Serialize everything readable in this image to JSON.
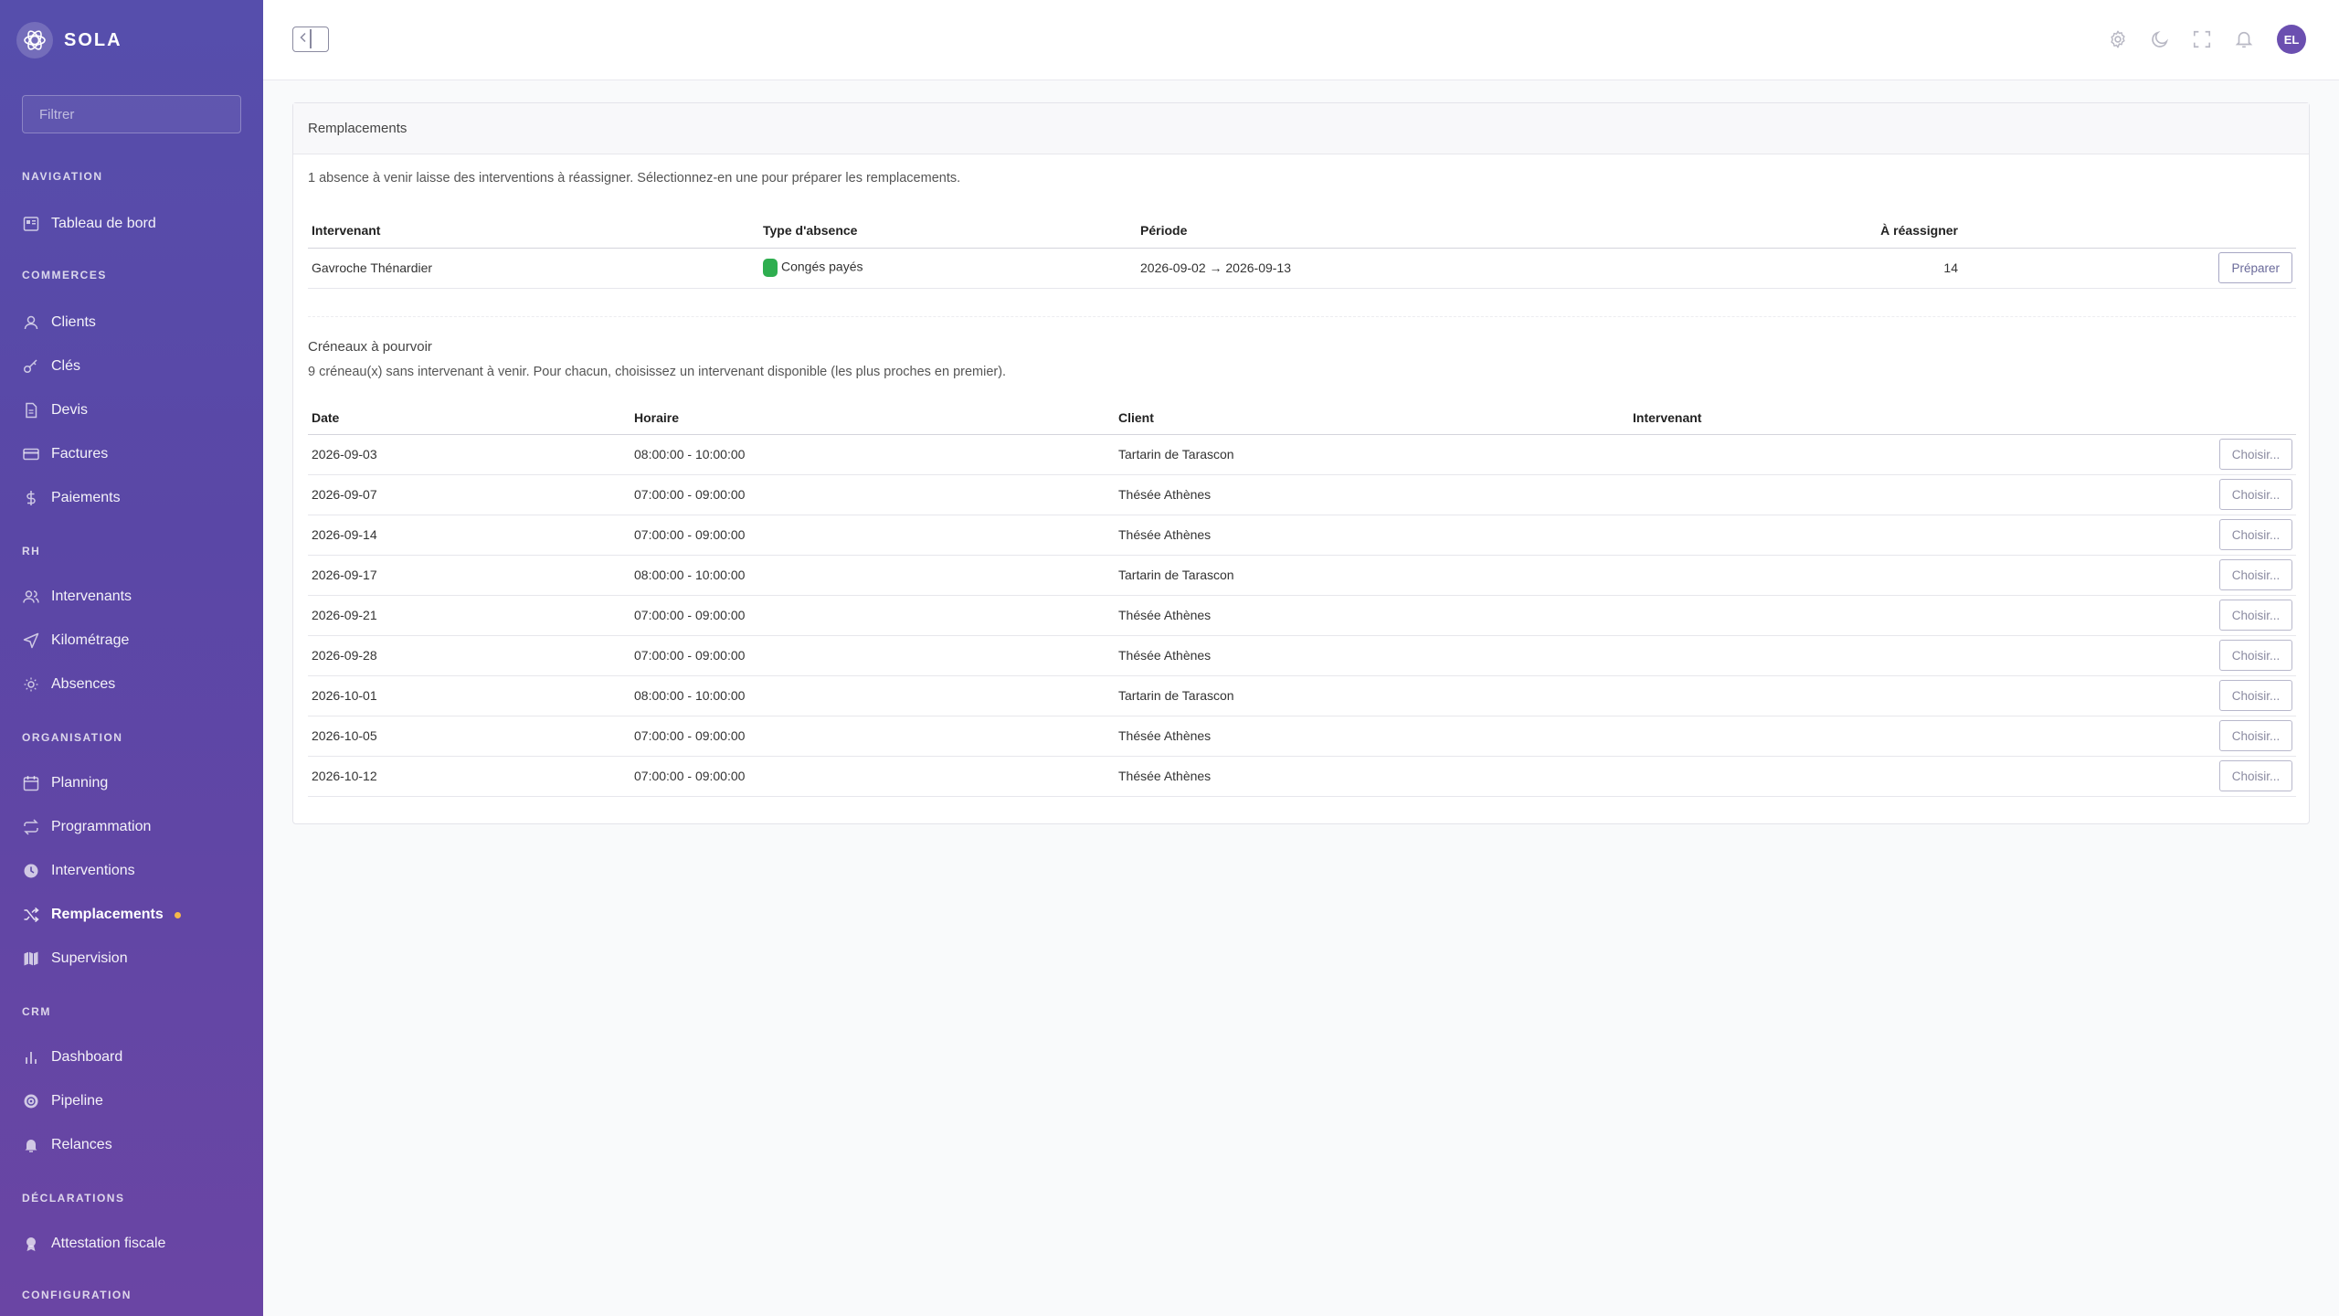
{
  "brand": {
    "name": "SOLA"
  },
  "sidebar": {
    "filter_placeholder": "Filtrer",
    "sections": {
      "navigation": "NAVIGATION",
      "commerces": "COMMERCES",
      "rh": "RH",
      "organisation": "ORGANISATION",
      "crm": "CRM",
      "declarations": "DÉCLARATIONS",
      "configuration": "CONFIGURATION"
    },
    "items": {
      "tableau": "Tableau de bord",
      "clients": "Clients",
      "cles": "Clés",
      "devis": "Devis",
      "factures": "Factures",
      "paiements": "Paiements",
      "intervenants": "Intervenants",
      "kilometrage": "Kilométrage",
      "absences": "Absences",
      "planning": "Planning",
      "programmation": "Programmation",
      "interventions": "Interventions",
      "remplacements": "Remplacements",
      "supervision": "Supervision",
      "dashboard": "Dashboard",
      "pipeline": "Pipeline",
      "relances": "Relances",
      "attestation": "Attestation fiscale"
    },
    "active": "Remplacements"
  },
  "topbar": {
    "avatar_initials": "EL"
  },
  "main": {
    "card_title": "Remplacements",
    "intro": "1 absence à venir laisse des interventions à réassigner. Sélectionnez-en une pour préparer les remplacements.",
    "absences_table": {
      "headers": {
        "intervenant": "Intervenant",
        "type": "Type d'absence",
        "periode": "Période",
        "reassigner": "À réassigner"
      },
      "rows": [
        {
          "intervenant": "Gavroche Thénardier",
          "type": "Congés payés",
          "type_color": "#2eae4f",
          "periode": "2026-09-02 → 2026-09-13",
          "reassigner": "14",
          "action": "Préparer"
        }
      ]
    },
    "slots": {
      "title": "Créneaux à pourvoir",
      "description": "9 créneau(x) sans intervenant à venir. Pour chacun, choisissez un intervenant disponible (les plus proches en premier).",
      "headers": {
        "date": "Date",
        "horaire": "Horaire",
        "client": "Client",
        "intervenant": "Intervenant"
      },
      "rows": [
        {
          "date": "2026-09-03",
          "horaire": "08:00:00 - 10:00:00",
          "client": "Tartarin de Tarascon",
          "intervenant": "",
          "action": "Choisir..."
        },
        {
          "date": "2026-09-07",
          "horaire": "07:00:00 - 09:00:00",
          "client": "Thésée Athènes",
          "intervenant": "",
          "action": "Choisir..."
        },
        {
          "date": "2026-09-14",
          "horaire": "07:00:00 - 09:00:00",
          "client": "Thésée Athènes",
          "intervenant": "",
          "action": "Choisir..."
        },
        {
          "date": "2026-09-17",
          "horaire": "08:00:00 - 10:00:00",
          "client": "Tartarin de Tarascon",
          "intervenant": "",
          "action": "Choisir..."
        },
        {
          "date": "2026-09-21",
          "horaire": "07:00:00 - 09:00:00",
          "client": "Thésée Athènes",
          "intervenant": "",
          "action": "Choisir..."
        },
        {
          "date": "2026-09-28",
          "horaire": "07:00:00 - 09:00:00",
          "client": "Thésée Athènes",
          "intervenant": "",
          "action": "Choisir..."
        },
        {
          "date": "2026-10-01",
          "horaire": "08:00:00 - 10:00:00",
          "client": "Tartarin de Tarascon",
          "intervenant": "",
          "action": "Choisir..."
        },
        {
          "date": "2026-10-05",
          "horaire": "07:00:00 - 09:00:00",
          "client": "Thésée Athènes",
          "intervenant": "",
          "action": "Choisir..."
        },
        {
          "date": "2026-10-12",
          "horaire": "07:00:00 - 09:00:00",
          "client": "Thésée Athènes",
          "intervenant": "",
          "action": "Choisir..."
        }
      ]
    }
  },
  "colors": {
    "sidebar_start": "#564eac",
    "sidebar_end": "#6a45a4",
    "accent": "#6b4fb0",
    "active_dot": "#f5b84a",
    "badge_green": "#2eae4f"
  }
}
